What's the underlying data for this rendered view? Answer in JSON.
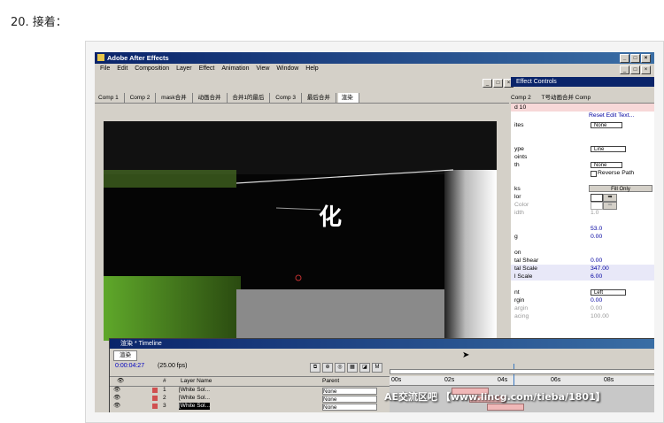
{
  "step_heading": "20. 接着：",
  "app": {
    "title": "Adobe After Effects",
    "menu": [
      "File",
      "Edit",
      "Composition",
      "Layer",
      "Effect",
      "Animation",
      "View",
      "Window",
      "Help"
    ]
  },
  "comp_tabs": [
    "Comp 1",
    "Comp 2",
    "mask合并",
    "动画合并",
    "合并1的最后",
    "Comp 3",
    "最后合并",
    "渲染"
  ],
  "viewer_text": "化",
  "effect_controls": {
    "title": "Effect Controls",
    "tabs": [
      "Comp 2",
      "T号动画合并 Comp"
    ],
    "layer": "d 10",
    "reset_link": "Reset Edit Text...",
    "rows": [
      {
        "label": "ites",
        "value": "None"
      },
      {
        "label": "ype",
        "value": "Line"
      },
      {
        "label": "oints",
        "value": ""
      },
      {
        "label": "th",
        "value": "None"
      },
      {
        "label": "",
        "value": "Reverse Path"
      },
      {
        "label": "ks",
        "value": "Fill Only"
      },
      {
        "label": "lor",
        "value": ""
      },
      {
        "label": "Color",
        "value": ""
      },
      {
        "label": "idth",
        "value": "1.0"
      },
      {
        "label": "",
        "value": "53.0"
      },
      {
        "label": "g",
        "value": "0.00"
      },
      {
        "label": "on",
        "value": ""
      },
      {
        "label": "tal Shear",
        "value": "0.00"
      },
      {
        "label": "tal Scale",
        "value": "347.00"
      },
      {
        "label": "l Scale",
        "value": "6.00"
      },
      {
        "label": "nt",
        "value": "Left"
      },
      {
        "label": "rgin",
        "value": "0.00"
      },
      {
        "label": "argin",
        "value": "0.00"
      },
      {
        "label": "acing",
        "value": "100.00"
      }
    ]
  },
  "timeline": {
    "title": "渲染 * Timeline",
    "tab": "渲染",
    "current_time": "0:00:04:27",
    "fps": "(25.00 fps)",
    "columns": [
      "#",
      "Layer Name",
      "Parent"
    ],
    "ruler": [
      "00s",
      "02s",
      "04s",
      "06s",
      "08s"
    ],
    "layers": [
      {
        "num": "1",
        "name": "[White Sol...",
        "parent": "None"
      },
      {
        "num": "2",
        "name": "[White Sol...",
        "parent": "None"
      },
      {
        "num": "3",
        "name": "[White Sol...",
        "parent": "None"
      }
    ]
  },
  "watermark": "AE交流区吧 【www.lincg.com/tieba/1801】",
  "colors": {
    "title_bar": "#0a246a",
    "panel": "#d4d0c8",
    "viewer_green": "#5fa82a"
  }
}
